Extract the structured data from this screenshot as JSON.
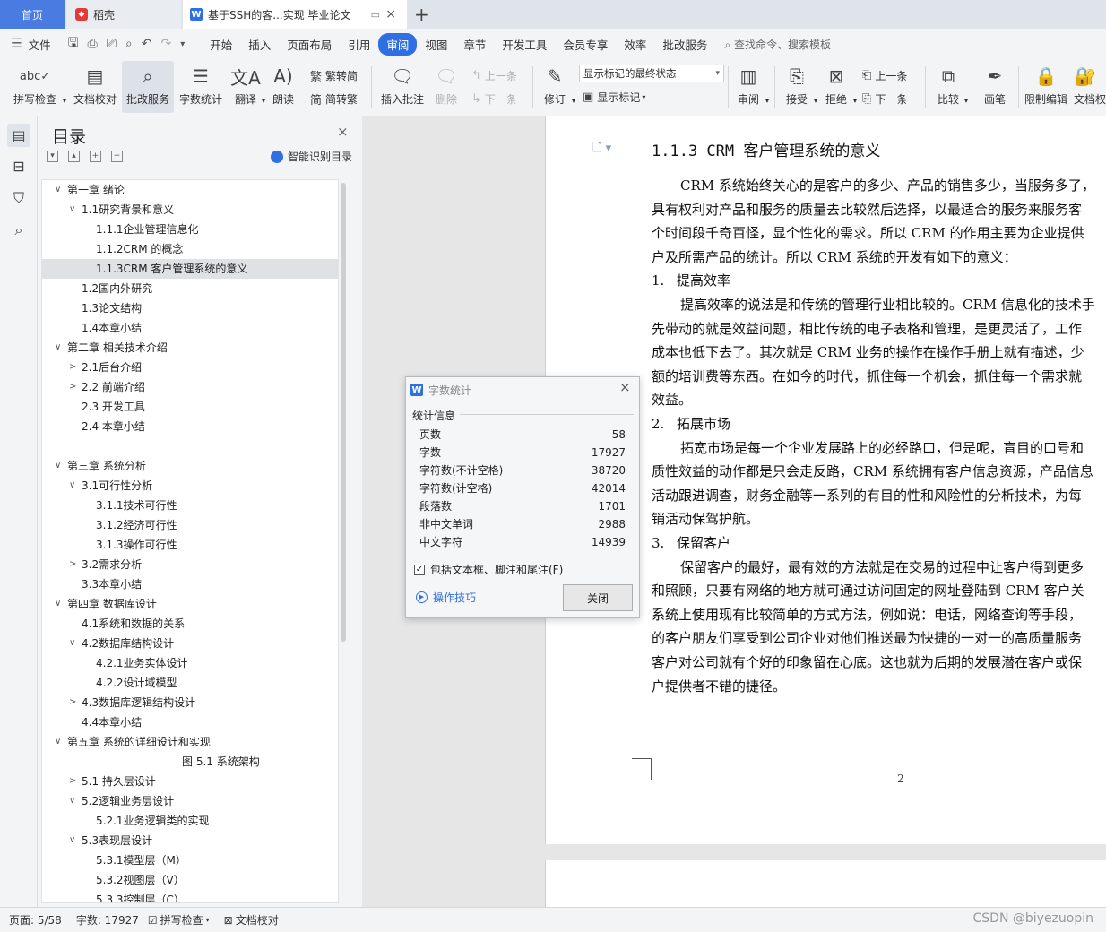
{
  "tabs": {
    "home": "首页",
    "docer": "稻壳",
    "doc": "基于SSH的客...实现 毕业论文",
    "close": "×",
    "add": "+"
  },
  "menu": {
    "file": "文件",
    "items": [
      "开始",
      "插入",
      "页面布局",
      "引用",
      "审阅",
      "视图",
      "章节",
      "开发工具",
      "会员专享",
      "效率",
      "批改服务"
    ],
    "search": "查找命令、搜索模板"
  },
  "ribbon": {
    "spell": "拼写检查",
    "proof": "文档校对",
    "correct": "批改服务",
    "wordcount": "字数统计",
    "translate": "翻译",
    "read": "朗读",
    "trad": "繁转简",
    "simp": "简转繁",
    "insert_comment": "插入批注",
    "delete": "删除",
    "prev": "上一条",
    "next": "下一条",
    "revise": "修订",
    "markup_state": "显示标记的最终状态",
    "show_markup": "显示标记",
    "review": "审阅",
    "accept": "接受",
    "reject": "拒绝",
    "prev2": "上一条",
    "next2": "下一条",
    "compare": "比较",
    "pen": "画笔",
    "restrict": "限制编辑",
    "docperm": "文档权"
  },
  "toc": {
    "title": "目录",
    "close": "×",
    "smart": "智能识别目录",
    "items": [
      {
        "text": "第一章  绪论",
        "level": 0,
        "arrow": "open"
      },
      {
        "text": "1.1研究背景和意义",
        "level": 1,
        "arrow": "open"
      },
      {
        "text": "1.1.1企业管理信息化",
        "level": 2,
        "arrow": ""
      },
      {
        "text": "1.1.2CRM 的概念",
        "level": 2,
        "arrow": ""
      },
      {
        "text": "1.1.3CRM 客户管理系统的意义",
        "level": 2,
        "arrow": "",
        "selected": true
      },
      {
        "text": "1.2国内外研究",
        "level": 1,
        "arrow": ""
      },
      {
        "text": "1.3论文结构",
        "level": 1,
        "arrow": ""
      },
      {
        "text": "1.4本章小结",
        "level": 1,
        "arrow": ""
      },
      {
        "text": "第二章  相关技术介绍",
        "level": 0,
        "arrow": "open"
      },
      {
        "text": "2.1后台介绍",
        "level": 1,
        "arrow": "closed"
      },
      {
        "text": "2.2 前端介绍",
        "level": 1,
        "arrow": "closed"
      },
      {
        "text": "2.3 开发工具",
        "level": 1,
        "arrow": ""
      },
      {
        "text": "2.4 本章小结",
        "level": 1,
        "arrow": ""
      },
      {
        "text": "",
        "level": 1,
        "arrow": ""
      },
      {
        "text": "第三章  系统分析",
        "level": 0,
        "arrow": "open"
      },
      {
        "text": "3.1可行性分析",
        "level": 1,
        "arrow": "open"
      },
      {
        "text": "3.1.1技术可行性",
        "level": 2,
        "arrow": ""
      },
      {
        "text": "3.1.2经济可行性",
        "level": 2,
        "arrow": ""
      },
      {
        "text": "3.1.3操作可行性",
        "level": 2,
        "arrow": ""
      },
      {
        "text": "3.2需求分析",
        "level": 1,
        "arrow": "closed"
      },
      {
        "text": "3.3本章小结",
        "level": 1,
        "arrow": ""
      },
      {
        "text": "第四章  数据库设计",
        "level": 0,
        "arrow": "open"
      },
      {
        "text": "4.1系统和数据的关系",
        "level": 1,
        "arrow": ""
      },
      {
        "text": "4.2数据库结构设计",
        "level": 1,
        "arrow": "open"
      },
      {
        "text": "4.2.1业务实体设计",
        "level": 2,
        "arrow": ""
      },
      {
        "text": "4.2.2设计域模型",
        "level": 2,
        "arrow": ""
      },
      {
        "text": "4.3数据库逻辑结构设计",
        "level": 1,
        "arrow": "closed"
      },
      {
        "text": "4.4本章小结",
        "level": 1,
        "arrow": ""
      },
      {
        "text": "第五章  系统的详细设计和实现",
        "level": 0,
        "arrow": "open"
      },
      {
        "text": "图 5.1 系统架构",
        "level": 3,
        "arrow": ""
      },
      {
        "text": "5.1 持久层设计",
        "level": 1,
        "arrow": "closed"
      },
      {
        "text": "5.2逻辑业务层设计",
        "level": 1,
        "arrow": "open"
      },
      {
        "text": "5.2.1业务逻辑类的实现",
        "level": 2,
        "arrow": ""
      },
      {
        "text": "5.3表现层设计",
        "level": 1,
        "arrow": "open"
      },
      {
        "text": "5.3.1模型层（M）",
        "level": 2,
        "arrow": ""
      },
      {
        "text": "5.3.2视图层（V）",
        "level": 2,
        "arrow": ""
      },
      {
        "text": "5.3.3控制层（C）",
        "level": 2,
        "arrow": ""
      }
    ]
  },
  "doc": {
    "heading": "1.1.3 CRM 客户管理系统的意义",
    "lines": [
      {
        "text": "CRM 系统始终关心的是客户的多少、产品的销售多少，当服务多了，",
        "kind": "indent"
      },
      {
        "text": "具有权利对产品和服务的质量去比较然后选择，以最适合的服务来服务客",
        "kind": "plain"
      },
      {
        "text": "个时间段千奇百怪，显个性化的需求。所以 CRM 的作用主要为企业提供",
        "kind": "plain"
      },
      {
        "text": "户及所需产品的统计。所以 CRM 系统的开发有如下的意义：",
        "kind": "plain"
      },
      {
        "num": "1.",
        "text": "提高效率",
        "kind": "sub"
      },
      {
        "text": "提高效率的说法是和传统的管理行业相比较的。CRM 信息化的技术手",
        "kind": "indent"
      },
      {
        "text": "先带动的就是效益问题，相比传统的电子表格和管理，是更灵活了，工作",
        "kind": "plain"
      },
      {
        "text": "成本也低下去了。其次就是 CRM 业务的操作在操作手册上就有描述，少",
        "kind": "plain"
      },
      {
        "text": "额的培训费等东西。在如今的时代，抓住每一个机会，抓住每一个需求就",
        "kind": "plain"
      },
      {
        "text": "效益。",
        "kind": "plain"
      },
      {
        "num": "2.",
        "text": "拓展市场",
        "kind": "sub"
      },
      {
        "text": "拓宽市场是每一个企业发展路上的必经路口，但是呢，盲目的口号和",
        "kind": "indent"
      },
      {
        "text": "质性效益的动作都是只会走反路，CRM 系统拥有客户信息资源，产品信息",
        "kind": "plain"
      },
      {
        "text": "活动跟进调查，财务金融等一系列的有目的性和风险性的分析技术，为每",
        "kind": "plain"
      },
      {
        "text": "销活动保驾护航。",
        "kind": "plain"
      },
      {
        "num": "3.",
        "text": "保留客户",
        "kind": "sub"
      },
      {
        "text": "保留客户的最好，最有效的方法就是在交易的过程中让客户得到更多",
        "kind": "indent"
      },
      {
        "text": "和照顾，只要有网络的地方就可通过访问固定的网址登陆到 CRM 客户关",
        "kind": "plain"
      },
      {
        "text": "系统上使用现有比较简单的方式方法，例如说：电话，网络查询等手段，",
        "kind": "plain"
      },
      {
        "text": "的客户朋友们享受到公司企业对他们推送最为快捷的一对一的高质量服务",
        "kind": "plain"
      },
      {
        "text": "客户对公司就有个好的印象留在心底。这也就为后期的发展潜在客户或保",
        "kind": "plain"
      },
      {
        "text": "户提供者不错的捷径。",
        "kind": "plain"
      }
    ],
    "page_number": "2"
  },
  "dialog": {
    "title": "字数统计",
    "close": "×",
    "group": "统计信息",
    "stats": [
      {
        "label": "页数",
        "value": "58"
      },
      {
        "label": "字数",
        "value": "17927"
      },
      {
        "label": "字符数(不计空格)",
        "value": "38720"
      },
      {
        "label": "字符数(计空格)",
        "value": "42014"
      },
      {
        "label": "段落数",
        "value": "1701"
      },
      {
        "label": "非中文单词",
        "value": "2988"
      },
      {
        "label": "中文字符",
        "value": "14939"
      }
    ],
    "include": "包括文本框、脚注和尾注(F)",
    "include_checked": true,
    "tips": "操作技巧",
    "close_button": "关闭"
  },
  "status": {
    "page": "页面: 5/58",
    "words": "字数: 17927",
    "spell": "拼写检查",
    "proof": "文档校对",
    "watermark": "CSDN @biyezuopin"
  },
  "colors": {
    "accent": "#2f6fe4",
    "selected_row": "#dfe1e5"
  }
}
